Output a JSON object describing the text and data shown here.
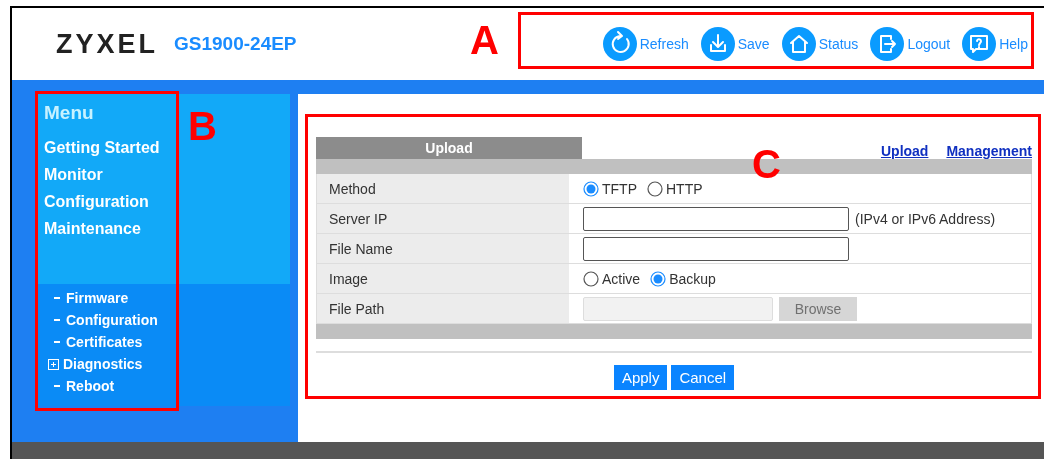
{
  "header": {
    "brand": "ZYXEL",
    "model": "GS1900-24EP",
    "toolbar": [
      {
        "kind": "refresh",
        "label": "Refresh"
      },
      {
        "kind": "save",
        "label": "Save"
      },
      {
        "kind": "status",
        "label": "Status"
      },
      {
        "kind": "logout",
        "label": "Logout"
      },
      {
        "kind": "help",
        "label": "Help"
      }
    ]
  },
  "sidebar": {
    "title": "Menu",
    "items": [
      "Getting Started",
      "Monitor",
      "Configuration",
      "Maintenance"
    ],
    "subitems": [
      {
        "label": "Firmware",
        "expandable": false
      },
      {
        "label": "Configuration",
        "expandable": false
      },
      {
        "label": "Certificates",
        "expandable": false
      },
      {
        "label": "Diagnostics",
        "expandable": true
      },
      {
        "label": "Reboot",
        "expandable": false
      }
    ]
  },
  "panel": {
    "tab": "Upload",
    "links": [
      "Upload",
      "Management"
    ],
    "rows": [
      {
        "kind": "radio",
        "label": "Method",
        "options": [
          {
            "label": "TFTP",
            "selected": true
          },
          {
            "label": "HTTP",
            "selected": false
          }
        ]
      },
      {
        "kind": "text",
        "label": "Server IP",
        "hint": "(IPv4 or IPv6 Address)"
      },
      {
        "kind": "text",
        "label": "File Name"
      },
      {
        "kind": "radio",
        "label": "Image",
        "options": [
          {
            "label": "Active",
            "selected": false
          },
          {
            "label": "Backup",
            "selected": true
          }
        ]
      },
      {
        "kind": "file",
        "label": "File Path",
        "button": "Browse",
        "disabled": true
      }
    ],
    "buttons": [
      "Apply",
      "Cancel"
    ]
  },
  "callouts": [
    {
      "label": "A"
    },
    {
      "label": "B"
    },
    {
      "label": "C"
    }
  ]
}
